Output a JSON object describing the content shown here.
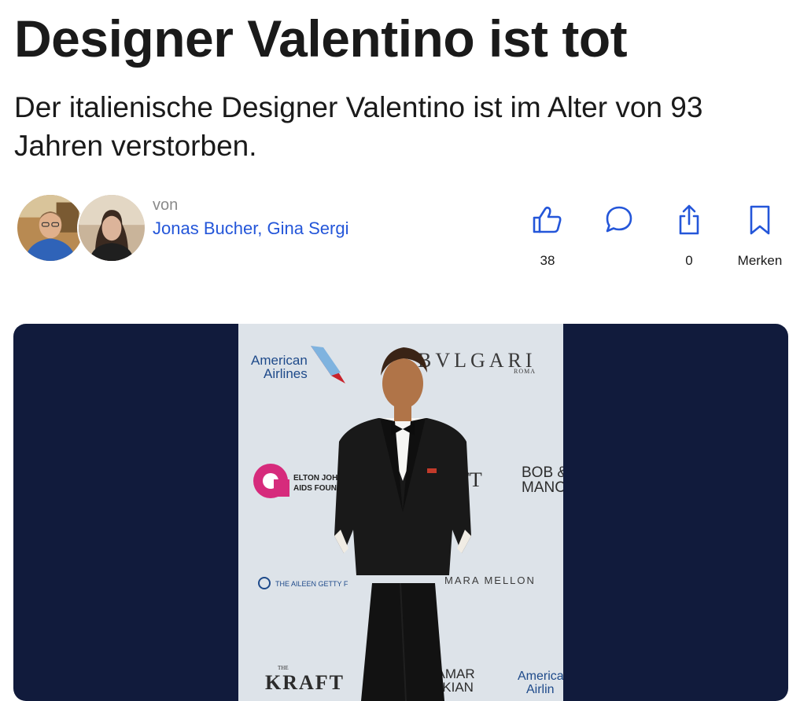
{
  "article": {
    "headline": "Designer Valentino ist tot",
    "lead": "Der italienische Designer Valentino ist im Alter von 93 Jahren verstorben."
  },
  "byline": {
    "prefix": "von",
    "authors": "Jonas Bucher, Gina Sergi"
  },
  "actions": {
    "like_count": "38",
    "comment_label": "",
    "share_count": "0",
    "save_label": "Merken"
  },
  "photo_backdrop": {
    "american_airlines_line1": "American",
    "american_airlines_line2": "Airlines",
    "bvlgari": "BVLGARI",
    "bvlgari_sub": "ROMA",
    "elton_line1": "ELTON JOHN",
    "elton_line2": "AIDS FOUNDATION",
    "kraft_right": "TT",
    "bob_line1": "BOB &",
    "bob_line2": "MANC",
    "aileen": "THE AILEEN GETTY F",
    "mara": "MARA MELLON",
    "kraft_bottom": "KRAFT",
    "the_small": "THE",
    "tamar_line1": "BOB & TAMAR",
    "tamar_line2": "MANOUKIAN",
    "aa_bottom_line1": "America",
    "aa_bottom_line2": "Airlin"
  },
  "colors": {
    "link": "#2456d9",
    "icon": "#2456d9",
    "media_bg": "#111b3c",
    "text": "#1a1a1a",
    "muted": "#8a8a8a"
  },
  "icons": {
    "like": "thumbs-up-icon",
    "comment": "speech-bubble-icon",
    "share": "share-icon",
    "save": "bookmark-icon"
  }
}
